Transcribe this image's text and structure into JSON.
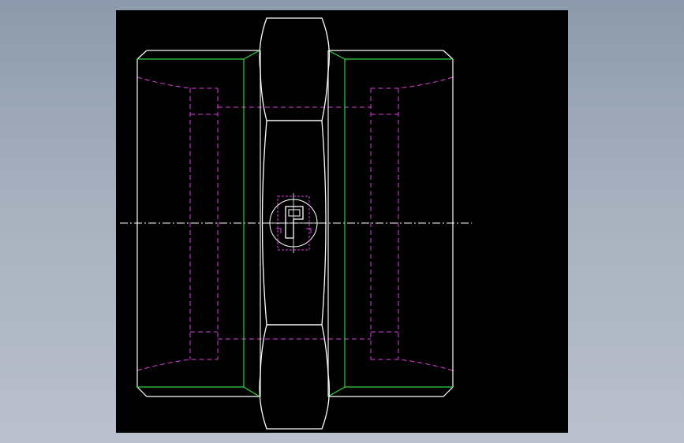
{
  "drawing": {
    "title": "",
    "view": "front",
    "colors": {
      "background": "#000000",
      "outline": "#ffffff",
      "hidden_lines": "#e03ce6",
      "tangent_edges": "#32d43a",
      "centerline": "#ffffff",
      "surround": "#a1abba"
    },
    "features": [
      "hex-nut-center",
      "threaded-end-left",
      "threaded-end-right",
      "internal-thread-hidden-lines",
      "axis-centerline",
      "brand-emblem"
    ]
  }
}
